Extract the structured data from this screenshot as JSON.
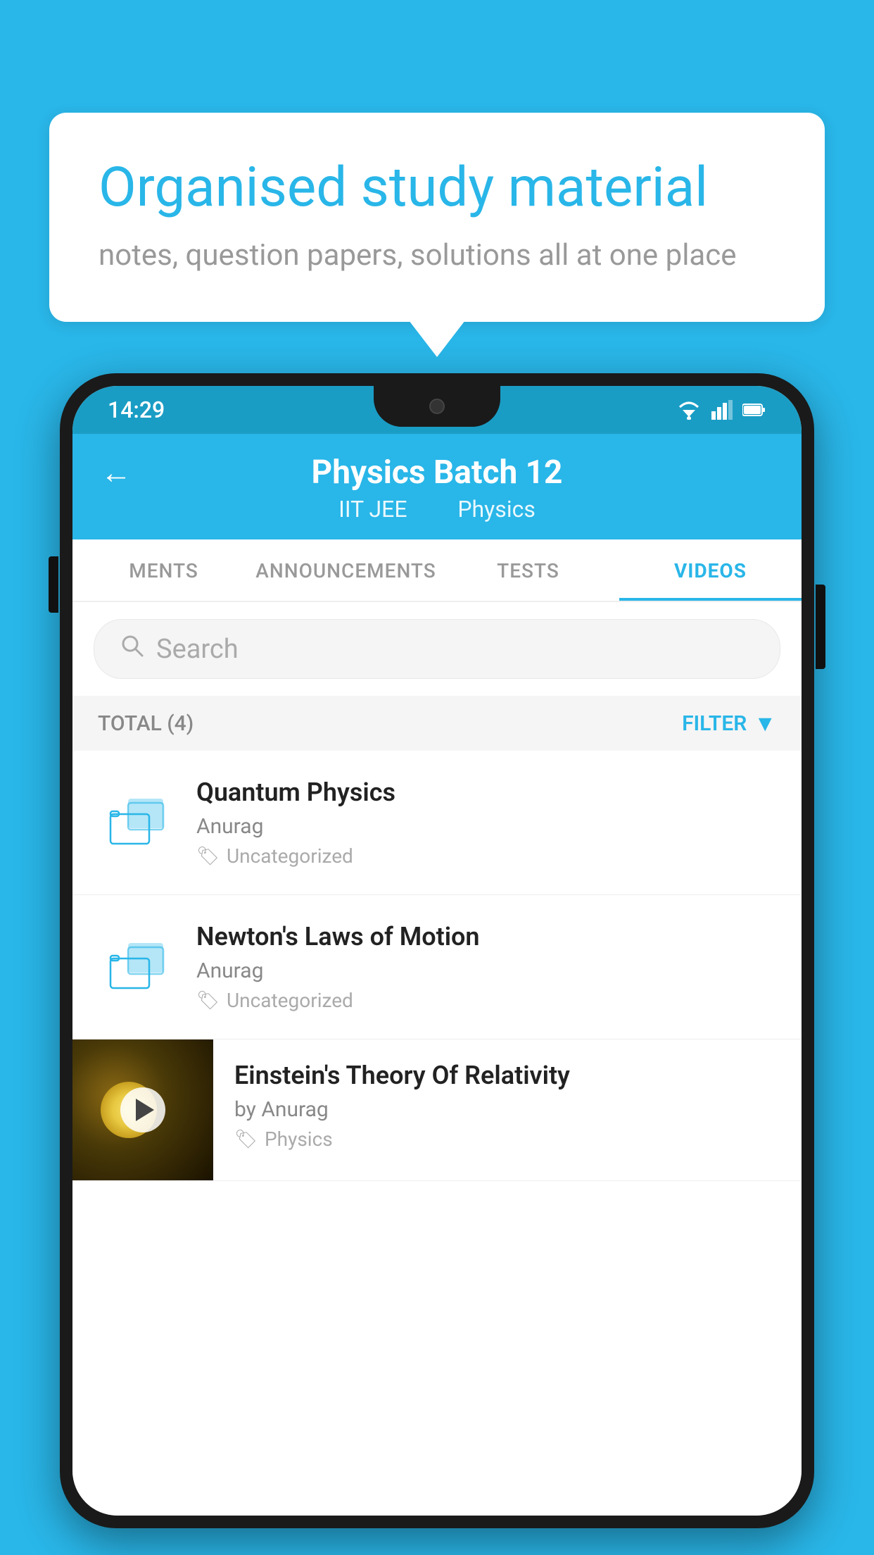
{
  "bubble": {
    "title": "Organised study material",
    "subtitle": "notes, question papers, solutions all at one place"
  },
  "status_bar": {
    "time": "14:29"
  },
  "header": {
    "title": "Physics Batch 12",
    "subtitle_part1": "IIT JEE",
    "subtitle_part2": "Physics",
    "back_label": "←"
  },
  "tabs": [
    {
      "label": "MENTS",
      "active": false
    },
    {
      "label": "ANNOUNCEMENTS",
      "active": false
    },
    {
      "label": "TESTS",
      "active": false
    },
    {
      "label": "VIDEOS",
      "active": true
    }
  ],
  "search": {
    "placeholder": "Search"
  },
  "filter_row": {
    "total_label": "TOTAL (4)",
    "filter_label": "FILTER"
  },
  "videos": [
    {
      "title": "Quantum Physics",
      "author": "Anurag",
      "tag": "Uncategorized",
      "has_thumb": false
    },
    {
      "title": "Newton's Laws of Motion",
      "author": "Anurag",
      "tag": "Uncategorized",
      "has_thumb": false
    },
    {
      "title": "Einstein's Theory Of Relativity",
      "author": "by Anurag",
      "tag": "Physics",
      "has_thumb": true
    }
  ]
}
